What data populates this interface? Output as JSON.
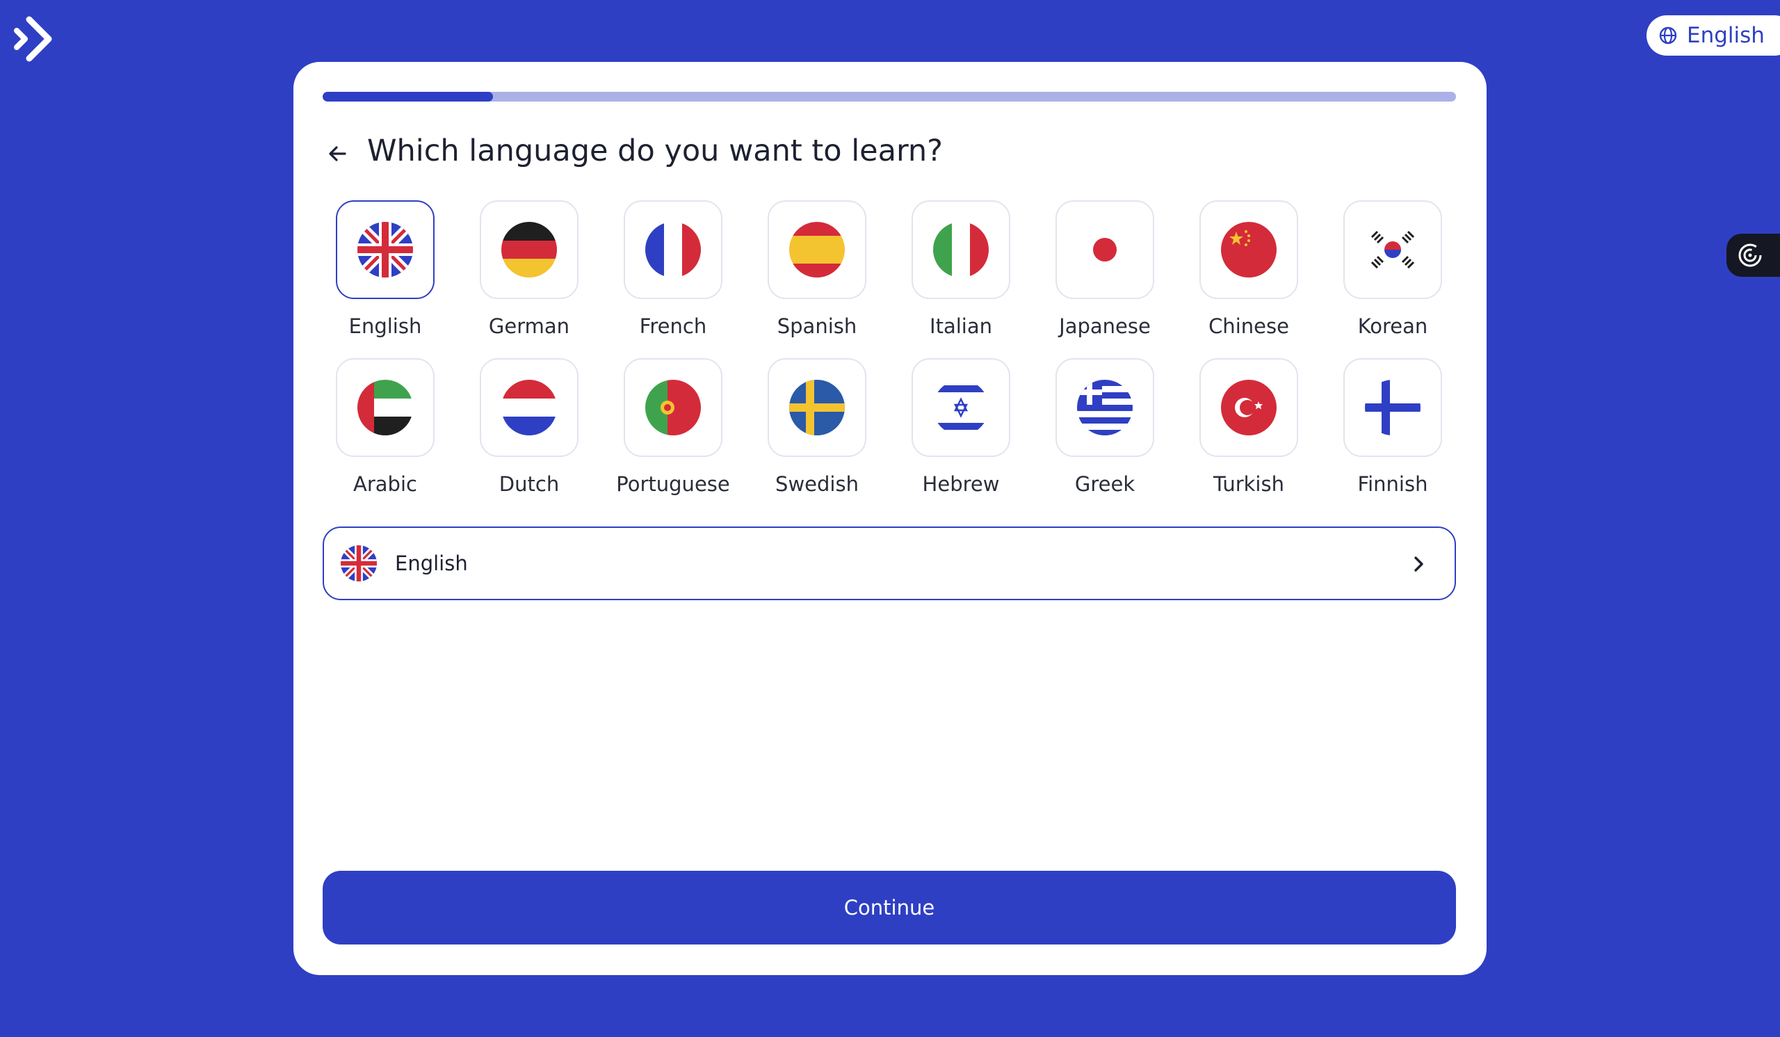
{
  "header": {
    "interface_language_label": "English"
  },
  "progress": {
    "fraction": 0.15
  },
  "question": {
    "title": "Which language do you want to learn?"
  },
  "languages": [
    {
      "label": "English",
      "flag": "gb-flag-icon",
      "selected": true
    },
    {
      "label": "German",
      "flag": "de-flag-icon"
    },
    {
      "label": "French",
      "flag": "fr-flag-icon"
    },
    {
      "label": "Spanish",
      "flag": "es-flag-icon"
    },
    {
      "label": "Italian",
      "flag": "it-flag-icon"
    },
    {
      "label": "Japanese",
      "flag": "jp-flag-icon"
    },
    {
      "label": "Chinese",
      "flag": "cn-flag-icon"
    },
    {
      "label": "Korean",
      "flag": "kr-flag-icon"
    },
    {
      "label": "Arabic",
      "flag": "ae-flag-icon"
    },
    {
      "label": "Dutch",
      "flag": "nl-flag-icon"
    },
    {
      "label": "Portuguese",
      "flag": "pt-flag-icon"
    },
    {
      "label": "Swedish",
      "flag": "se-flag-icon"
    },
    {
      "label": "Hebrew",
      "flag": "il-flag-icon"
    },
    {
      "label": "Greek",
      "flag": "gr-flag-icon"
    },
    {
      "label": "Turkish",
      "flag": "tr-flag-icon"
    },
    {
      "label": "Finnish",
      "flag": "fi-flag-icon"
    }
  ],
  "selection": {
    "label": "English"
  },
  "actions": {
    "continue_label": "Continue"
  },
  "colors": {
    "background": "#2f3fc4",
    "accent": "#2f3fc4",
    "progress_track": "#aab1e6"
  }
}
